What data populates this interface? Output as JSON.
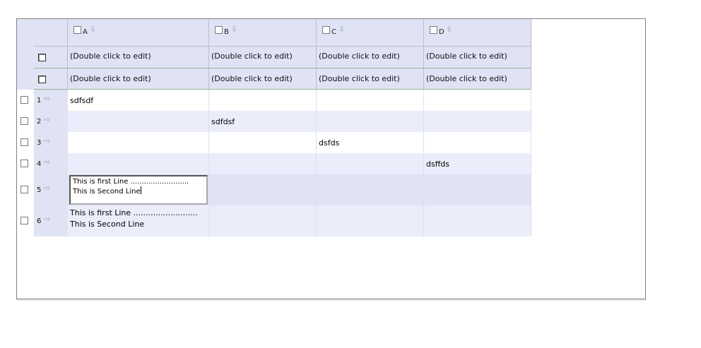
{
  "columns": [
    "A",
    "B",
    "C",
    "D"
  ],
  "filter_rows": [
    [
      "(Double click to edit)",
      "(Double click to edit)",
      "(Double click to edit)",
      "(Double click to edit)"
    ],
    [
      "(Double click to edit)",
      "(Double click to edit)",
      "(Double click to edit)",
      "(Double click to edit)"
    ]
  ],
  "rows": [
    {
      "num": "1",
      "cells": [
        "sdfsdf",
        "",
        "",
        ""
      ]
    },
    {
      "num": "2",
      "cells": [
        "",
        "sdfdsf",
        "",
        ""
      ]
    },
    {
      "num": "3",
      "cells": [
        "",
        "",
        "dsfds",
        ""
      ]
    },
    {
      "num": "4",
      "cells": [
        "",
        "",
        "",
        "dsffds"
      ]
    },
    {
      "num": "5",
      "editing": true,
      "editor_lines": [
        "This is first Line ..........................",
        "This is Second Line"
      ]
    },
    {
      "num": "6",
      "lines": [
        "This is first Line ..........................",
        "This is Second Line"
      ]
    }
  ],
  "colors": {
    "header_bg": "#dfe3f4",
    "alt_row_bg": "#ebedfa",
    "selected_row_bg": "#dfe3f4",
    "white": "#ffffff"
  },
  "icons": {
    "sort": "arrow-down-icon",
    "row_marker": "arrow-right-icon"
  }
}
